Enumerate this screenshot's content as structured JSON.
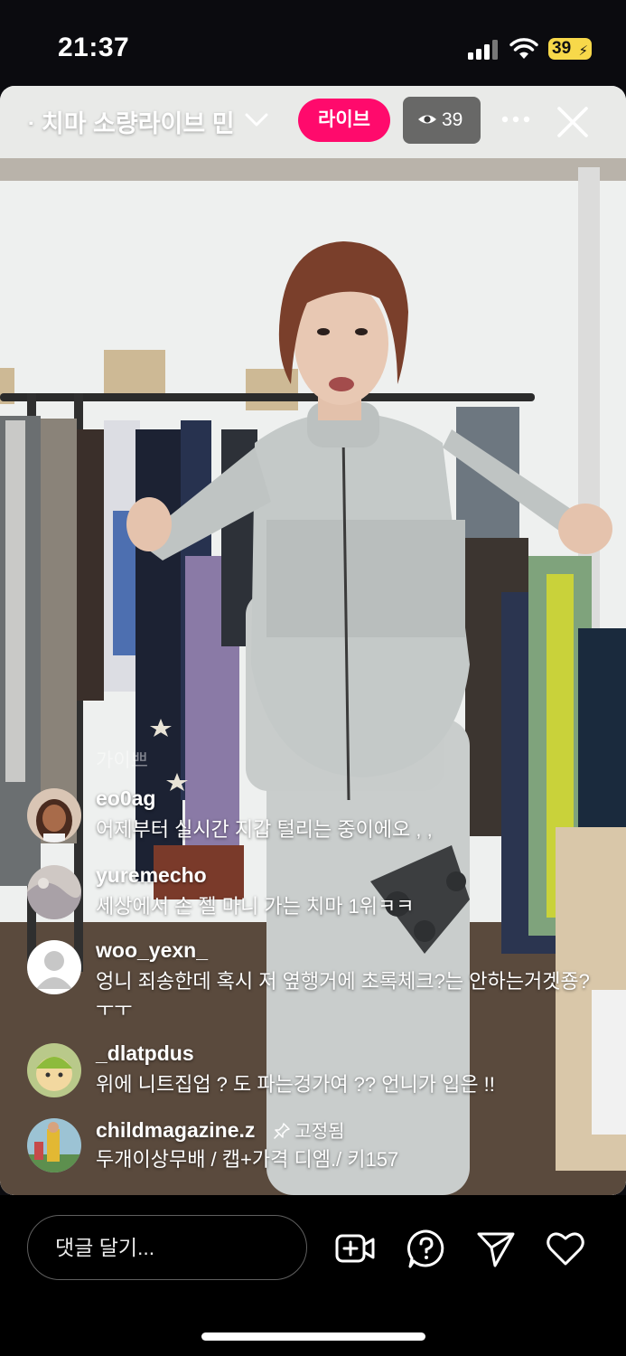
{
  "status_bar": {
    "time": "21:37",
    "battery": "39"
  },
  "live": {
    "title": "ᐧ 치마 소량라이브 민",
    "live_label": "라이브",
    "viewer_count": "39"
  },
  "comments": [
    {
      "username": "eo0ag",
      "text": "어제부터 실시간 지갑 털리는 중이에오 , ,"
    },
    {
      "username": "yuremecho",
      "text": "세상에서 손 젤 마니 가는 치마 1위ㅋㅋ"
    },
    {
      "username": "woo_yexn_",
      "text": "엉니 죄송한데 혹시 저 옆행거에 초록체크?는 안하는거겟죵?ㅜㅜ"
    },
    {
      "username": "_dlatpdus",
      "text": "위에 니트집업 ? 도 파는겅가여 ?? 언니가 입은 !!"
    },
    {
      "username": "childmagazine.z",
      "pinned_label": "고정됨",
      "text": "두개이상무배 / 캡+가격 디엠./ 키157"
    }
  ],
  "faded_comment": "가이쁘",
  "bottom_bar": {
    "comment_placeholder": "댓글 달기..."
  },
  "icons": [
    "video-add-icon",
    "question-icon",
    "send-icon",
    "heart-icon",
    "eye-icon",
    "pin-icon",
    "close-icon",
    "more-icon",
    "chevron-down-icon"
  ],
  "colors": {
    "live_badge": "#ff0a6c",
    "battery": "#f7d84a",
    "background": "#000000"
  }
}
